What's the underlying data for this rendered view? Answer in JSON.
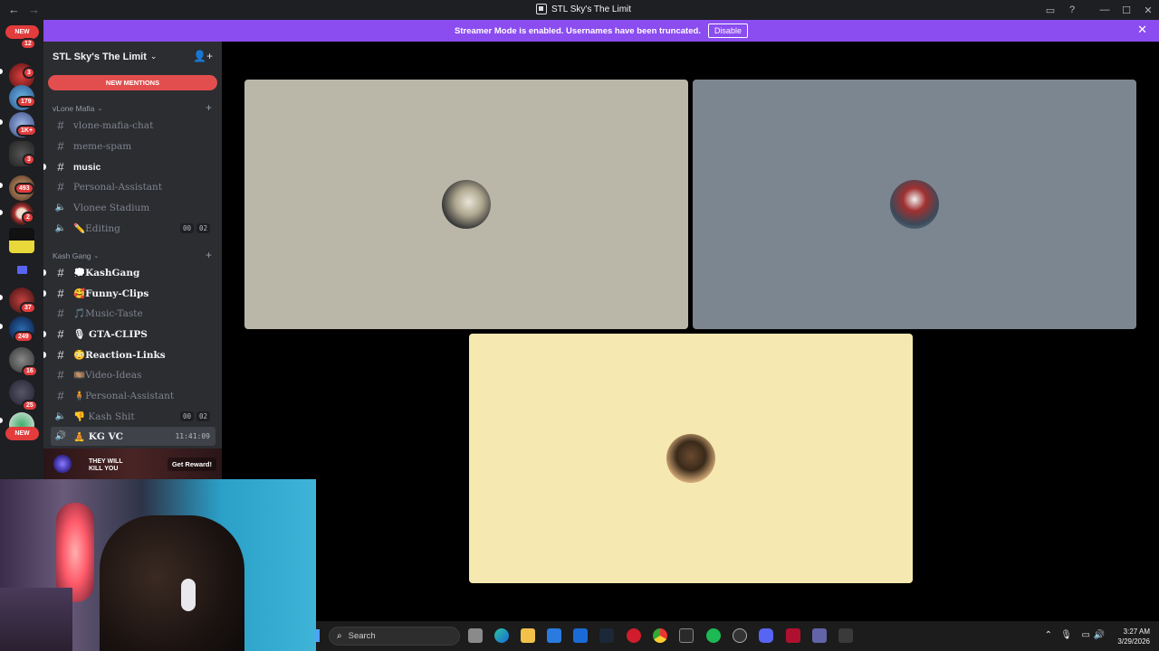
{
  "window": {
    "title": "STL Sky's The Limit"
  },
  "banner": {
    "message": "Streamer Mode is enabled. Usernames have been truncated.",
    "disable_label": "Disable"
  },
  "rail": {
    "new_top": "NEW",
    "new_bottom": "NEW",
    "badges": [
      "12",
      "3",
      "179",
      "1K+",
      "3",
      "493",
      "2",
      "37",
      "249",
      "16",
      "25"
    ]
  },
  "server": {
    "name": "STL Sky's The Limit",
    "new_mentions": "NEW MENTIONS",
    "categories": [
      {
        "name": "vLone Mafia"
      },
      {
        "name": "Kash Gang"
      }
    ],
    "channels": [
      {
        "name": "vlone-mafia-chat"
      },
      {
        "name": "meme-spam"
      },
      {
        "name": "music"
      },
      {
        "name": "Personal-Assistant"
      },
      {
        "name": "Vlonee Stadium"
      },
      {
        "name": "✏️Editing",
        "count_a": "00",
        "count_b": "02"
      },
      {
        "name": "💭KashGang"
      },
      {
        "name": "🥰Funny-Clips"
      },
      {
        "name": "🎵Music-Taste"
      },
      {
        "name": "🎙 GTA-CLIPS"
      },
      {
        "name": "😳Reaction-Links"
      },
      {
        "name": "🎞️Video-Ideas"
      },
      {
        "name": "🧍Personal-Assistant"
      },
      {
        "name": "👎 Kash Shit",
        "count_a": "00",
        "count_b": "02"
      },
      {
        "name": "🧘 KG VC",
        "timer": "11:41:09"
      }
    ]
  },
  "promo": {
    "title_line1": "THEY WILL",
    "title_line2": "KILL YOU",
    "cta": "Get Reward!"
  },
  "tiles": {
    "colors": [
      "#bab7a9",
      "#7c8690",
      "#f5e8b0"
    ]
  },
  "taskbar": {
    "search_placeholder": "Search",
    "time": "3:27 AM",
    "date": "3/29/2026"
  }
}
